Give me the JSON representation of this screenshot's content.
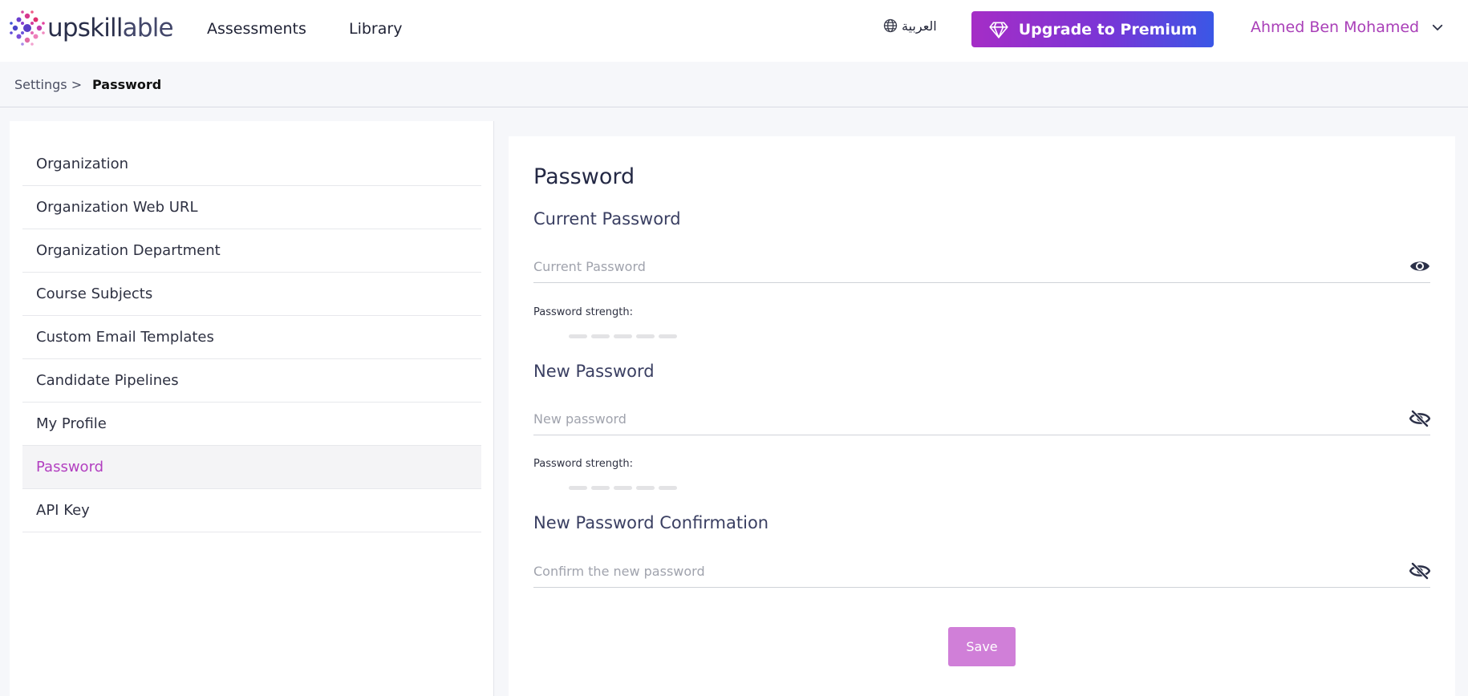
{
  "header": {
    "logo_text_bold": "upskill",
    "logo_text_light": "able",
    "nav": [
      "Assessments",
      "Library"
    ],
    "language_label": "العربية",
    "premium_label": "Upgrade to Premium",
    "user_name": "Ahmed Ben Mohamed"
  },
  "breadcrumb": {
    "parent": "Settings >",
    "current": "Password"
  },
  "sidebar": {
    "items": [
      {
        "label": "Organization"
      },
      {
        "label": "Organization Web URL"
      },
      {
        "label": "Organization Department"
      },
      {
        "label": "Course Subjects"
      },
      {
        "label": "Custom Email Templates"
      },
      {
        "label": "Candidate Pipelines"
      },
      {
        "label": "My Profile"
      },
      {
        "label": "Password",
        "active": true
      },
      {
        "label": "API Key"
      }
    ]
  },
  "form": {
    "title": "Password",
    "current": {
      "label": "Current Password",
      "placeholder": "Current Password",
      "value": "",
      "strength_label": "Password strength:",
      "strength_level": 0,
      "visibility_icon": "eye-icon"
    },
    "new": {
      "label": "New Password",
      "placeholder": "New password",
      "value": "",
      "strength_label": "Password strength:",
      "strength_level": 0,
      "visibility_icon": "eye-slash-icon"
    },
    "confirm": {
      "label": "New Password Confirmation",
      "placeholder": "Confirm the new password",
      "value": "",
      "visibility_icon": "eye-slash-icon"
    },
    "save_label": "Save"
  },
  "colors": {
    "accent": "#b23fc0",
    "premium_gradient_start": "#a52dc6",
    "premium_gradient_end": "#3a57e6",
    "save_button": "#d07fd8",
    "strength_empty": "#e3e3e5"
  }
}
